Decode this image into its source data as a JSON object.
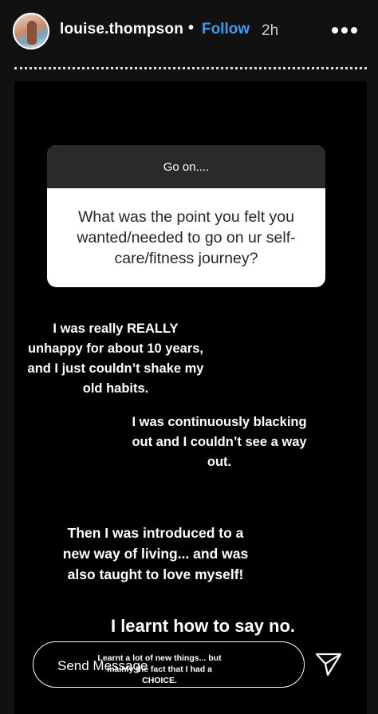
{
  "header": {
    "username": "louise.thompson",
    "separator": "•",
    "follow_label": "Follow",
    "time": "2h"
  },
  "story": {
    "question_prompt": "Go on....",
    "question_text": "What was the point you felt you wanted/needed to go on ur self-care/fitness journey?",
    "captions": [
      "I was really REALLY unhappy for about 10 years, and I just couldn’t shake my old habits.",
      "I was continuously blacking out and I couldn’t see a way out.",
      "Then I was introduced to a new way of living... and was also taught to love myself!",
      "I learnt how to say no.",
      "Learnt a lot of new things... but mainly the fact that I had a CHOICE."
    ]
  },
  "footer": {
    "message_placeholder": "Send Message"
  },
  "icons": {
    "more": "more-horizontal-icon",
    "send": "paper-plane-icon"
  },
  "colors": {
    "follow": "#3b9cf0",
    "background": "#000000",
    "question_header": "#2a2a2a"
  }
}
